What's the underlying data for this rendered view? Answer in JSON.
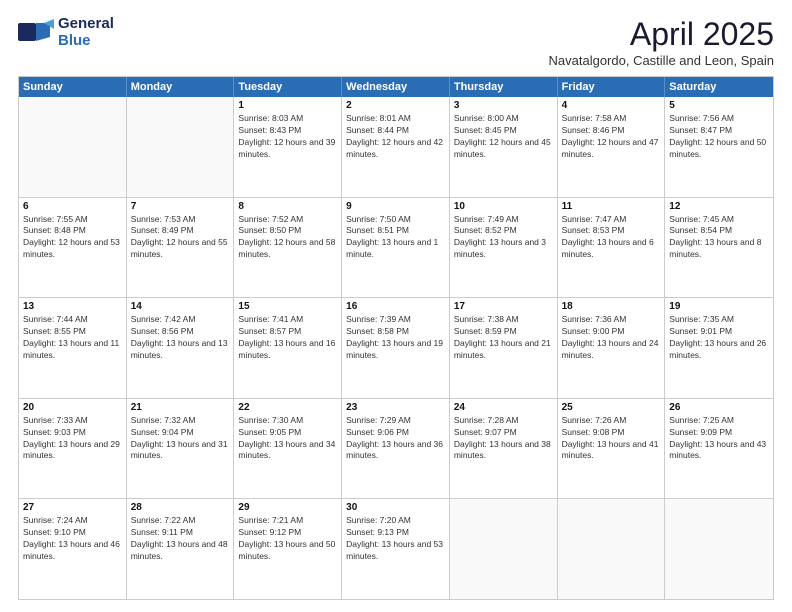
{
  "header": {
    "logo_general": "General",
    "logo_blue": "Blue",
    "month_title": "April 2025",
    "subtitle": "Navatalgordo, Castille and Leon, Spain"
  },
  "weekdays": [
    "Sunday",
    "Monday",
    "Tuesday",
    "Wednesday",
    "Thursday",
    "Friday",
    "Saturday"
  ],
  "rows": [
    [
      {
        "day": "",
        "info": ""
      },
      {
        "day": "",
        "info": ""
      },
      {
        "day": "1",
        "info": "Sunrise: 8:03 AM\nSunset: 8:43 PM\nDaylight: 12 hours and 39 minutes."
      },
      {
        "day": "2",
        "info": "Sunrise: 8:01 AM\nSunset: 8:44 PM\nDaylight: 12 hours and 42 minutes."
      },
      {
        "day": "3",
        "info": "Sunrise: 8:00 AM\nSunset: 8:45 PM\nDaylight: 12 hours and 45 minutes."
      },
      {
        "day": "4",
        "info": "Sunrise: 7:58 AM\nSunset: 8:46 PM\nDaylight: 12 hours and 47 minutes."
      },
      {
        "day": "5",
        "info": "Sunrise: 7:56 AM\nSunset: 8:47 PM\nDaylight: 12 hours and 50 minutes."
      }
    ],
    [
      {
        "day": "6",
        "info": "Sunrise: 7:55 AM\nSunset: 8:48 PM\nDaylight: 12 hours and 53 minutes."
      },
      {
        "day": "7",
        "info": "Sunrise: 7:53 AM\nSunset: 8:49 PM\nDaylight: 12 hours and 55 minutes."
      },
      {
        "day": "8",
        "info": "Sunrise: 7:52 AM\nSunset: 8:50 PM\nDaylight: 12 hours and 58 minutes."
      },
      {
        "day": "9",
        "info": "Sunrise: 7:50 AM\nSunset: 8:51 PM\nDaylight: 13 hours and 1 minute."
      },
      {
        "day": "10",
        "info": "Sunrise: 7:49 AM\nSunset: 8:52 PM\nDaylight: 13 hours and 3 minutes."
      },
      {
        "day": "11",
        "info": "Sunrise: 7:47 AM\nSunset: 8:53 PM\nDaylight: 13 hours and 6 minutes."
      },
      {
        "day": "12",
        "info": "Sunrise: 7:45 AM\nSunset: 8:54 PM\nDaylight: 13 hours and 8 minutes."
      }
    ],
    [
      {
        "day": "13",
        "info": "Sunrise: 7:44 AM\nSunset: 8:55 PM\nDaylight: 13 hours and 11 minutes."
      },
      {
        "day": "14",
        "info": "Sunrise: 7:42 AM\nSunset: 8:56 PM\nDaylight: 13 hours and 13 minutes."
      },
      {
        "day": "15",
        "info": "Sunrise: 7:41 AM\nSunset: 8:57 PM\nDaylight: 13 hours and 16 minutes."
      },
      {
        "day": "16",
        "info": "Sunrise: 7:39 AM\nSunset: 8:58 PM\nDaylight: 13 hours and 19 minutes."
      },
      {
        "day": "17",
        "info": "Sunrise: 7:38 AM\nSunset: 8:59 PM\nDaylight: 13 hours and 21 minutes."
      },
      {
        "day": "18",
        "info": "Sunrise: 7:36 AM\nSunset: 9:00 PM\nDaylight: 13 hours and 24 minutes."
      },
      {
        "day": "19",
        "info": "Sunrise: 7:35 AM\nSunset: 9:01 PM\nDaylight: 13 hours and 26 minutes."
      }
    ],
    [
      {
        "day": "20",
        "info": "Sunrise: 7:33 AM\nSunset: 9:03 PM\nDaylight: 13 hours and 29 minutes."
      },
      {
        "day": "21",
        "info": "Sunrise: 7:32 AM\nSunset: 9:04 PM\nDaylight: 13 hours and 31 minutes."
      },
      {
        "day": "22",
        "info": "Sunrise: 7:30 AM\nSunset: 9:05 PM\nDaylight: 13 hours and 34 minutes."
      },
      {
        "day": "23",
        "info": "Sunrise: 7:29 AM\nSunset: 9:06 PM\nDaylight: 13 hours and 36 minutes."
      },
      {
        "day": "24",
        "info": "Sunrise: 7:28 AM\nSunset: 9:07 PM\nDaylight: 13 hours and 38 minutes."
      },
      {
        "day": "25",
        "info": "Sunrise: 7:26 AM\nSunset: 9:08 PM\nDaylight: 13 hours and 41 minutes."
      },
      {
        "day": "26",
        "info": "Sunrise: 7:25 AM\nSunset: 9:09 PM\nDaylight: 13 hours and 43 minutes."
      }
    ],
    [
      {
        "day": "27",
        "info": "Sunrise: 7:24 AM\nSunset: 9:10 PM\nDaylight: 13 hours and 46 minutes."
      },
      {
        "day": "28",
        "info": "Sunrise: 7:22 AM\nSunset: 9:11 PM\nDaylight: 13 hours and 48 minutes."
      },
      {
        "day": "29",
        "info": "Sunrise: 7:21 AM\nSunset: 9:12 PM\nDaylight: 13 hours and 50 minutes."
      },
      {
        "day": "30",
        "info": "Sunrise: 7:20 AM\nSunset: 9:13 PM\nDaylight: 13 hours and 53 minutes."
      },
      {
        "day": "",
        "info": ""
      },
      {
        "day": "",
        "info": ""
      },
      {
        "day": "",
        "info": ""
      }
    ]
  ]
}
